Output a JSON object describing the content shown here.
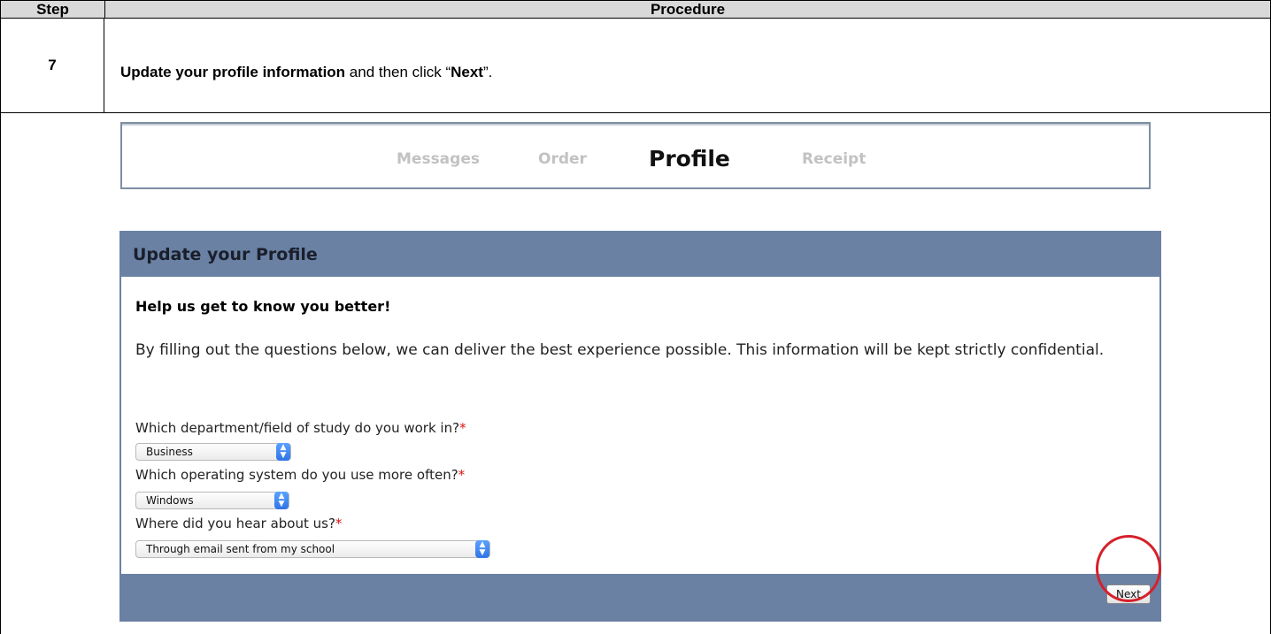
{
  "table": {
    "header_step": "Step",
    "header_procedure": "Procedure",
    "step_number": "7",
    "instruction_bold": "Update your profile information",
    "instruction_mid": " and then click “",
    "instruction_next": "Next",
    "instruction_end": "”."
  },
  "nav": {
    "items": [
      "Messages",
      "Order",
      "Profile",
      "Receipt"
    ],
    "active": "Profile"
  },
  "panel": {
    "title": "Update your Profile",
    "heading": "Help us get to know you better!",
    "intro": "By filling out the questions below, we can deliver the best experience possible. This information will be kept strictly confidential.",
    "required_mark": "*",
    "questions": [
      {
        "label": "Which department/field of study do you work in?",
        "value": "Business"
      },
      {
        "label": "Which operating system do you use more often?",
        "value": "Windows"
      },
      {
        "label": "Where did you hear about us?",
        "value": "Through email sent from my school"
      }
    ],
    "next_label": "Next"
  },
  "colors": {
    "header_bg": "#d9d9d9",
    "panel_blue": "#6a81a4",
    "highlight_circle": "#d4212b",
    "required": "#dd1111"
  },
  "icons": {
    "select_arrow": "chevron-up-down-icon"
  }
}
